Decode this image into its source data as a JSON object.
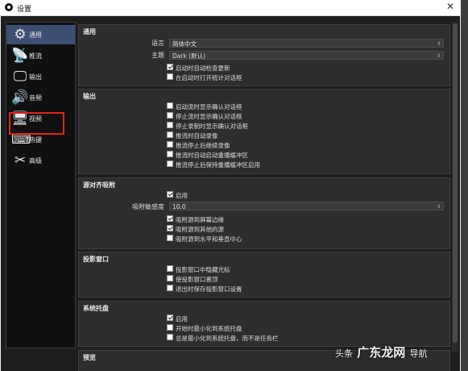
{
  "window": {
    "title": "设置"
  },
  "sidebar": {
    "items": [
      {
        "label": "通用",
        "icon": "gear-icon",
        "glyph": "⚙"
      },
      {
        "label": "推流",
        "icon": "antenna-icon",
        "glyph": "📡"
      },
      {
        "label": "输出",
        "icon": "monitor-output-icon",
        "glyph": "🖵"
      },
      {
        "label": "音频",
        "icon": "speaker-icon",
        "glyph": "🔊"
      },
      {
        "label": "视频",
        "icon": "display-icon",
        "glyph": "🖥"
      },
      {
        "label": "热键",
        "icon": "keyboard-icon",
        "glyph": "⌨"
      },
      {
        "label": "高级",
        "icon": "tools-icon",
        "glyph": "✂"
      }
    ],
    "selected_index": 0
  },
  "general": {
    "title": "通用",
    "language_label": "语言",
    "language_value": "简体中文",
    "theme_label": "主题",
    "theme_value": "Dark (默认)",
    "checkboxes": [
      {
        "label": "启动时自动检查更新",
        "checked": true
      },
      {
        "label": "在启动时打开统计对话框",
        "checked": false
      }
    ]
  },
  "output": {
    "title": "输出",
    "checkboxes": [
      {
        "label": "启动流时显示确认对话框",
        "checked": false
      },
      {
        "label": "停止流时显示确认对话框",
        "checked": false
      },
      {
        "label": "停止录制时显示确认对话框",
        "checked": false
      },
      {
        "label": "推流时自动录像",
        "checked": false
      },
      {
        "label": "推流停止后继续录像",
        "checked": false
      },
      {
        "label": "推流时自动启动重播缓冲区",
        "checked": false
      },
      {
        "label": "推流停止后保持重播缓冲区启用",
        "checked": false
      }
    ]
  },
  "snapping": {
    "title": "源对齐吸附",
    "enable": {
      "label": "启用",
      "checked": true
    },
    "sensitivity_label": "吸附敏感度",
    "sensitivity_value": "10.0",
    "checkboxes": [
      {
        "label": "吸附源到屏幕边缘",
        "checked": true
      },
      {
        "label": "吸附源到其他的源",
        "checked": true
      },
      {
        "label": "吸附源到水平和垂直中心",
        "checked": false
      }
    ]
  },
  "projectors": {
    "title": "投影窗口",
    "checkboxes": [
      {
        "label": "投影窗口中隐藏光标",
        "checked": false
      },
      {
        "label": "使投影窗口置顶",
        "checked": false
      },
      {
        "label": "退出时保存投影窗口设置",
        "checked": false
      }
    ]
  },
  "tray": {
    "title": "系统托盘",
    "checkboxes": [
      {
        "label": "启用",
        "checked": true
      },
      {
        "label": "开始时最小化到系统托盘",
        "checked": false
      },
      {
        "label": "总是最小化到系统托盘，而不是任务栏",
        "checked": false
      }
    ]
  },
  "next_group_title": "预览",
  "watermark": {
    "prefix": "头条",
    "main": "广东龙网",
    "suffix": "导航"
  },
  "colors": {
    "selected": "#3c4f73",
    "highlight_box": "#e1251b",
    "panel": "#2d2c2e"
  }
}
